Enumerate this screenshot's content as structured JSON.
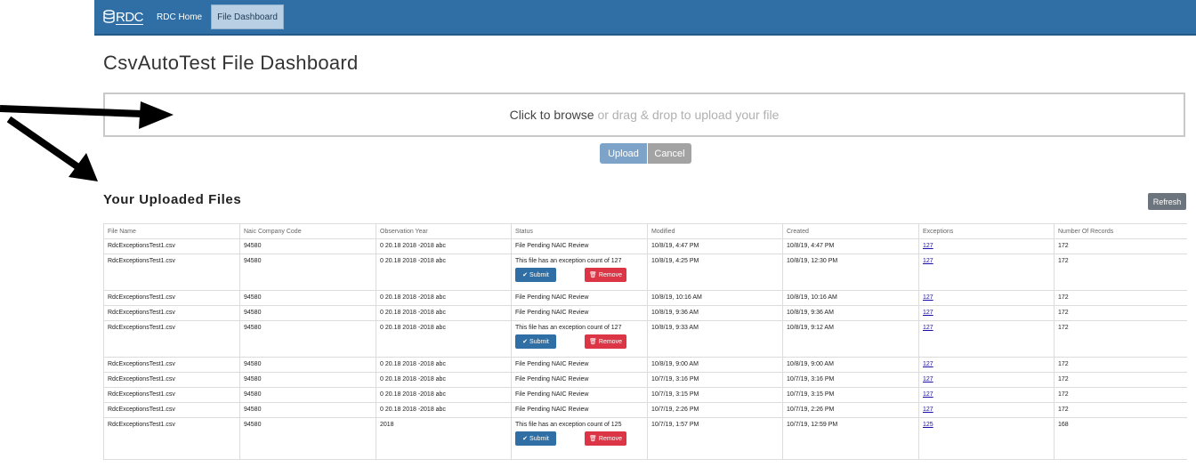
{
  "nav": {
    "brand": "RDC",
    "links": [
      {
        "label": "RDC Home",
        "active": false
      },
      {
        "label": "File Dashboard",
        "active": true
      }
    ]
  },
  "page": {
    "title": "CsvAutoTest File Dashboard"
  },
  "upload": {
    "browse_text": "Click to browse",
    "rest_text": "or drag & drop to upload your file",
    "upload_label": "Upload",
    "cancel_label": "Cancel"
  },
  "files": {
    "title": "Your Uploaded Files",
    "refresh_label": "Refresh",
    "columns": [
      "File Name",
      "Naic Company Code",
      "Observation Year",
      "Status",
      "Modified",
      "Created",
      "Exceptions",
      "Number Of Records"
    ],
    "submit_label": "Submit",
    "remove_label": "Remove",
    "rows": [
      {
        "name": "RdcExceptionsTest1.csv",
        "naic": "94580",
        "year": "0 20.18 2018 -2018 abc",
        "status": "File Pending NAIC Review",
        "modified": "10/8/19, 4:47 PM",
        "created": "10/8/19, 4:47 PM",
        "exceptions": "127",
        "records": "172",
        "actions": false
      },
      {
        "name": "RdcExceptionsTest1.csv",
        "naic": "94580",
        "year": "0 20.18 2018 -2018 abc",
        "status": "This file has an exception count of 127",
        "modified": "10/8/19, 4:25 PM",
        "created": "10/8/19, 12:30 PM",
        "exceptions": "127",
        "records": "172",
        "actions": true
      },
      {
        "name": "RdcExceptionsTest1.csv",
        "naic": "94580",
        "year": "0 20.18 2018 -2018 abc",
        "status": "File Pending NAIC Review",
        "modified": "10/8/19, 10:16 AM",
        "created": "10/8/19, 10:16 AM",
        "exceptions": "127",
        "records": "172",
        "actions": false
      },
      {
        "name": "RdcExceptionsTest1.csv",
        "naic": "94580",
        "year": "0 20.18 2018 -2018 abc",
        "status": "File Pending NAIC Review",
        "modified": "10/8/19, 9:36 AM",
        "created": "10/8/19, 9:36 AM",
        "exceptions": "127",
        "records": "172",
        "actions": false
      },
      {
        "name": "RdcExceptionsTest1.csv",
        "naic": "94580",
        "year": "0 20.18 2018 -2018 abc",
        "status": "This file has an exception count of 127",
        "modified": "10/8/19, 9:33 AM",
        "created": "10/8/19, 9:12 AM",
        "exceptions": "127",
        "records": "172",
        "actions": true
      },
      {
        "name": "RdcExceptionsTest1.csv",
        "naic": "94580",
        "year": "0 20.18 2018 -2018 abc",
        "status": "File Pending NAIC Review",
        "modified": "10/8/19, 9:00 AM",
        "created": "10/8/19, 9:00 AM",
        "exceptions": "127",
        "records": "172",
        "actions": false
      },
      {
        "name": "RdcExceptionsTest1.csv",
        "naic": "94580",
        "year": "0 20.18 2018 -2018 abc",
        "status": "File Pending NAIC Review",
        "modified": "10/7/19, 3:16 PM",
        "created": "10/7/19, 3:16 PM",
        "exceptions": "127",
        "records": "172",
        "actions": false
      },
      {
        "name": "RdcExceptionsTest1.csv",
        "naic": "94580",
        "year": "0 20.18 2018 -2018 abc",
        "status": "File Pending NAIC Review",
        "modified": "10/7/19, 3:15 PM",
        "created": "10/7/19, 3:15 PM",
        "exceptions": "127",
        "records": "172",
        "actions": false
      },
      {
        "name": "RdcExceptionsTest1.csv",
        "naic": "94580",
        "year": "0 20.18 2018 -2018 abc",
        "status": "File Pending NAIC Review",
        "modified": "10/7/19, 2:26 PM",
        "created": "10/7/19, 2:26 PM",
        "exceptions": "127",
        "records": "172",
        "actions": false
      },
      {
        "name": "RdcExceptionsTest1.csv",
        "naic": "94580",
        "year": "2018",
        "status": "This file has an exception count of 125",
        "modified": "10/7/19, 1:57 PM",
        "created": "10/7/19, 12:59 PM",
        "exceptions": "125",
        "records": "168",
        "actions": true
      }
    ]
  },
  "colors": {
    "navbar": "#2f6fa5",
    "submit": "#2f6fa5",
    "remove": "#dc3545",
    "refresh": "#6c757d"
  },
  "icons": {
    "submit": "check-icon",
    "remove": "trash-icon",
    "annotation": "arrow-icon"
  }
}
